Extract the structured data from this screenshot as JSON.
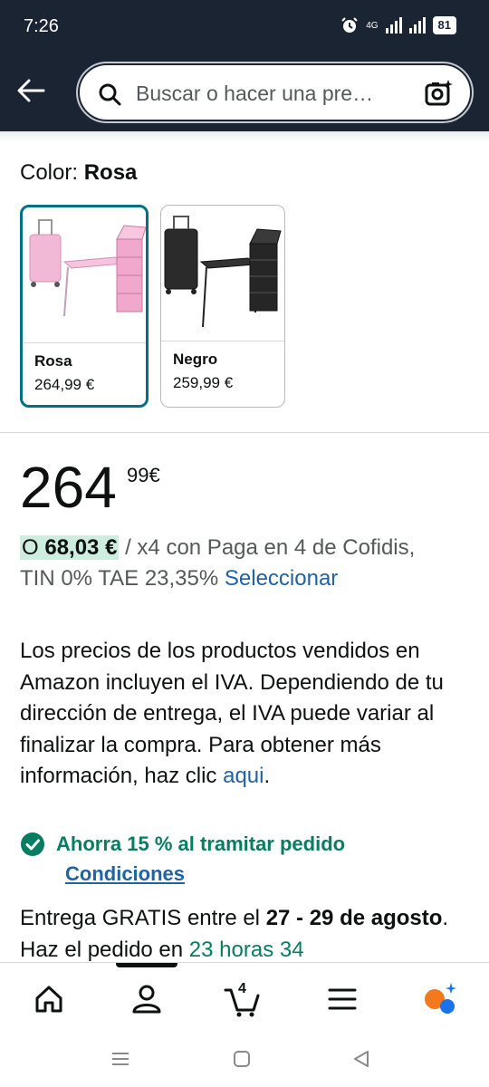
{
  "status_bar": {
    "time": "7:26",
    "network": "4G",
    "battery": "81"
  },
  "header": {
    "back_icon": "arrow-left-icon",
    "search_placeholder": "Buscar o hacer una pre…",
    "camera_icon": "camera-sparkle-icon"
  },
  "color_selector": {
    "label": "Color:",
    "selected": "Rosa",
    "options": [
      {
        "name": "Rosa",
        "price": "264,99 €",
        "selected": true
      },
      {
        "name": "Negro",
        "price": "259,99 €",
        "selected": false
      }
    ]
  },
  "price": {
    "whole": "264",
    "fraction": "99",
    "currency": "€"
  },
  "installments": {
    "prefix": "O ",
    "amount": "68,03 €",
    "text": " / x4 con Paga en 4 de Cofidis,",
    "rates": "TIN 0% TAE 23,35% ",
    "select_link": "Seleccionar"
  },
  "vat_notice": {
    "text": "Los precios de los productos vendidos en Amazon incluyen el IVA. Dependiendo de tu dirección de entrega, el IVA puede variar al finalizar la compra. Para obtener más información, haz clic ",
    "link": "aqui",
    "suffix": "."
  },
  "savings": {
    "icon": "check-circle-icon",
    "text": "Ahorra 15 % al tramitar pedido",
    "conditions_link": "Condiciones"
  },
  "delivery": {
    "prefix": "Entrega GRATIS entre el ",
    "dates": "27 - 29 de agosto",
    "middle": ". Haz el pedido en ",
    "countdown": "23 horas 34"
  },
  "bottom_nav": {
    "items": [
      "home-icon",
      "account-icon",
      "cart-icon",
      "menu-icon",
      "rufus-icon"
    ],
    "cart_count": "4"
  },
  "colors": {
    "header_bg": "#1b2433",
    "selected_border": "#007185",
    "link": "#2162a1",
    "green": "#067d62",
    "highlight_bg": "#cdeedf"
  }
}
